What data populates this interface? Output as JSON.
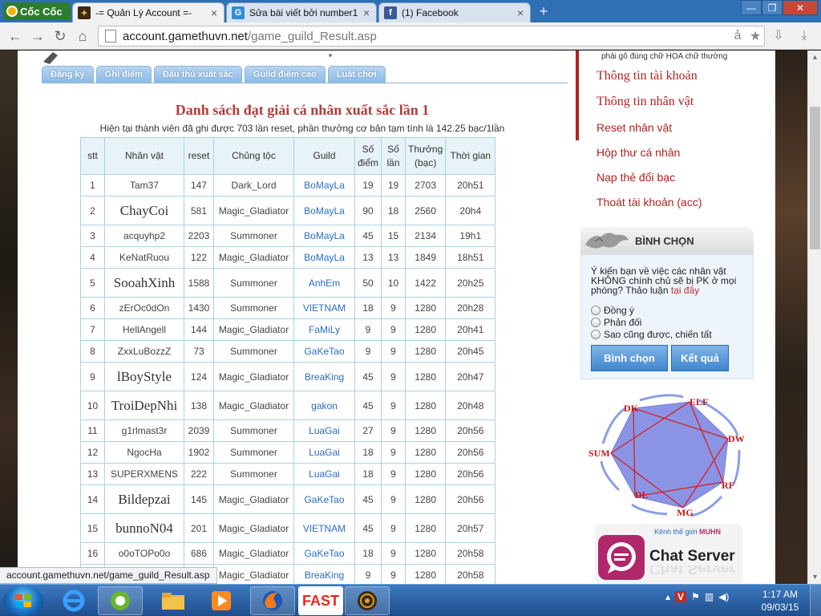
{
  "browser": {
    "brand": "Cốc Cốc",
    "tabs": [
      {
        "title": "-= Quản Lý Account =-",
        "active": true
      },
      {
        "title": "Sửa bài viết bởi number1 |",
        "active": false
      },
      {
        "title": "(1) Facebook",
        "active": false
      }
    ],
    "url_host": "account.gamethuvn.net",
    "url_path": "/game_guild_Result.asp"
  },
  "nav": {
    "tabs": [
      "Đăng ký",
      "Ghi điểm",
      "Đấu thủ xuất sắc",
      "Guild điểm cao",
      "Luật chơi"
    ]
  },
  "main": {
    "title": "Danh sách đạt giải cá nhân xuất sắc lần 1",
    "subtitle": "Hiện tại thành viên đã ghi được 703 lần reset, phần thưởng cơ bản tạm tính là 142.25 bạc/1lần",
    "columns": [
      "stt",
      "Nhân vật",
      "reset",
      "Chủng tộc",
      "Guild",
      "Số điểm",
      "Số lần",
      "Thưởng (bạc)",
      "Thời gian"
    ],
    "rows": [
      {
        "stt": "1",
        "name": "Tam37",
        "reset": "147",
        "race": "Dark_Lord",
        "guild": "BoMayLa",
        "points": "19",
        "times": "19",
        "reward": "2703",
        "time": "20h51",
        "big": false
      },
      {
        "stt": "2",
        "name": "ChayCoi",
        "reset": "581",
        "race": "Magic_Gladiator",
        "guild": "BoMayLa",
        "points": "90",
        "times": "18",
        "reward": "2560",
        "time": "20h4",
        "big": true
      },
      {
        "stt": "3",
        "name": "acquyhp2",
        "reset": "2203",
        "race": "Summoner",
        "guild": "BoMayLa",
        "points": "45",
        "times": "15",
        "reward": "2134",
        "time": "19h1",
        "big": false
      },
      {
        "stt": "4",
        "name": "KeNatRuou",
        "reset": "122",
        "race": "Magic_Gladiator",
        "guild": "BoMayLa",
        "points": "13",
        "times": "13",
        "reward": "1849",
        "time": "18h51",
        "big": false
      },
      {
        "stt": "5",
        "name": "SooahXinh",
        "reset": "1588",
        "race": "Summoner",
        "guild": "AnhEm",
        "points": "50",
        "times": "10",
        "reward": "1422",
        "time": "20h25",
        "big": true
      },
      {
        "stt": "6",
        "name": "zErOc0dOn",
        "reset": "1430",
        "race": "Summoner",
        "guild": "VIETNAM",
        "points": "18",
        "times": "9",
        "reward": "1280",
        "time": "20h28",
        "big": false
      },
      {
        "stt": "7",
        "name": "HellAngell",
        "reset": "144",
        "race": "Magic_Gladiator",
        "guild": "FaMiLy",
        "points": "9",
        "times": "9",
        "reward": "1280",
        "time": "20h41",
        "big": false
      },
      {
        "stt": "8",
        "name": "ZxxLuBozzZ",
        "reset": "73",
        "race": "Summoner",
        "guild": "GaKeTao",
        "points": "9",
        "times": "9",
        "reward": "1280",
        "time": "20h45",
        "big": false
      },
      {
        "stt": "9",
        "name": "lBoyStyle",
        "reset": "124",
        "race": "Magic_Gladiator",
        "guild": "BreaKing",
        "points": "45",
        "times": "9",
        "reward": "1280",
        "time": "20h47",
        "big": true
      },
      {
        "stt": "10",
        "name": "TroiDepNhi",
        "reset": "138",
        "race": "Magic_Gladiator",
        "guild": "gakon",
        "points": "45",
        "times": "9",
        "reward": "1280",
        "time": "20h48",
        "big": true
      },
      {
        "stt": "11",
        "name": "g1rlmast3r",
        "reset": "2039",
        "race": "Summoner",
        "guild": "LuaGai",
        "points": "27",
        "times": "9",
        "reward": "1280",
        "time": "20h56",
        "big": false
      },
      {
        "stt": "12",
        "name": "NgocHa",
        "reset": "1902",
        "race": "Summoner",
        "guild": "LuaGai",
        "points": "18",
        "times": "9",
        "reward": "1280",
        "time": "20h56",
        "big": false
      },
      {
        "stt": "13",
        "name": "SUPERXMENS",
        "reset": "222",
        "race": "Summoner",
        "guild": "LuaGai",
        "points": "18",
        "times": "9",
        "reward": "1280",
        "time": "20h56",
        "big": false
      },
      {
        "stt": "14",
        "name": "Bildepzai",
        "reset": "145",
        "race": "Magic_Gladiator",
        "guild": "GaKeTao",
        "points": "45",
        "times": "9",
        "reward": "1280",
        "time": "20h56",
        "big": true
      },
      {
        "stt": "15",
        "name": "bunnoN04",
        "reset": "201",
        "race": "Magic_Gladiator",
        "guild": "VIETNAM",
        "points": "45",
        "times": "9",
        "reward": "1280",
        "time": "20h57",
        "big": true
      },
      {
        "stt": "16",
        "name": "o0oTOPo0o",
        "reset": "686",
        "race": "Magic_Gladiator",
        "guild": "GaKeTao",
        "points": "18",
        "times": "9",
        "reward": "1280",
        "time": "20h58",
        "big": false
      },
      {
        "stt": "",
        "name": "",
        "reset": "",
        "race": "Magic_Gladiator",
        "guild": "BreaKing",
        "points": "9",
        "times": "9",
        "reward": "1280",
        "time": "20h58",
        "big": false
      }
    ]
  },
  "sidebar": {
    "note": "phải gõ đúng chữ HOA chữ thường",
    "account_links": [
      {
        "label": "Thông tin tài khoản",
        "big": true
      },
      {
        "label": "Thông tin nhân vật",
        "big": true
      },
      {
        "label": "Reset nhân vật",
        "big": false
      },
      {
        "label": "Hộp thư cá nhân",
        "big": false
      },
      {
        "label": "Nạp thẻ đổi bạc",
        "big": false
      },
      {
        "label": "Thoát tài khoản (acc)",
        "big": false
      }
    ],
    "poll": {
      "heading": "BÌNH CHỌN",
      "question": "Ý kiến bạn về việc các nhân vật KHÔNG chính chủ sẽ bị PK ở mọi phòng? Thảo luận",
      "question_link": "tại đây",
      "options": [
        "Đồng ý",
        "Phản đối",
        "Sao cũng được, chiến tất"
      ],
      "vote_label": "Bình chọn",
      "result_label": "Kết quả"
    },
    "diagram_labels": [
      "DK",
      "ELF",
      "DW",
      "RF",
      "MG",
      "DL",
      "SUM"
    ],
    "chat": {
      "kicker": "Kênh thế giới",
      "kicker_brand": "MUHN",
      "title": "Chat Server"
    }
  },
  "status_text": "account.gamethuvn.net/game_guild_Result.asp",
  "taskbar": {
    "apps": [
      "ie",
      "coccoc",
      "explorer",
      "media",
      "firefox",
      "FAST",
      "game"
    ],
    "clock_time": "1:17 AM",
    "clock_date": "09/03/15"
  }
}
